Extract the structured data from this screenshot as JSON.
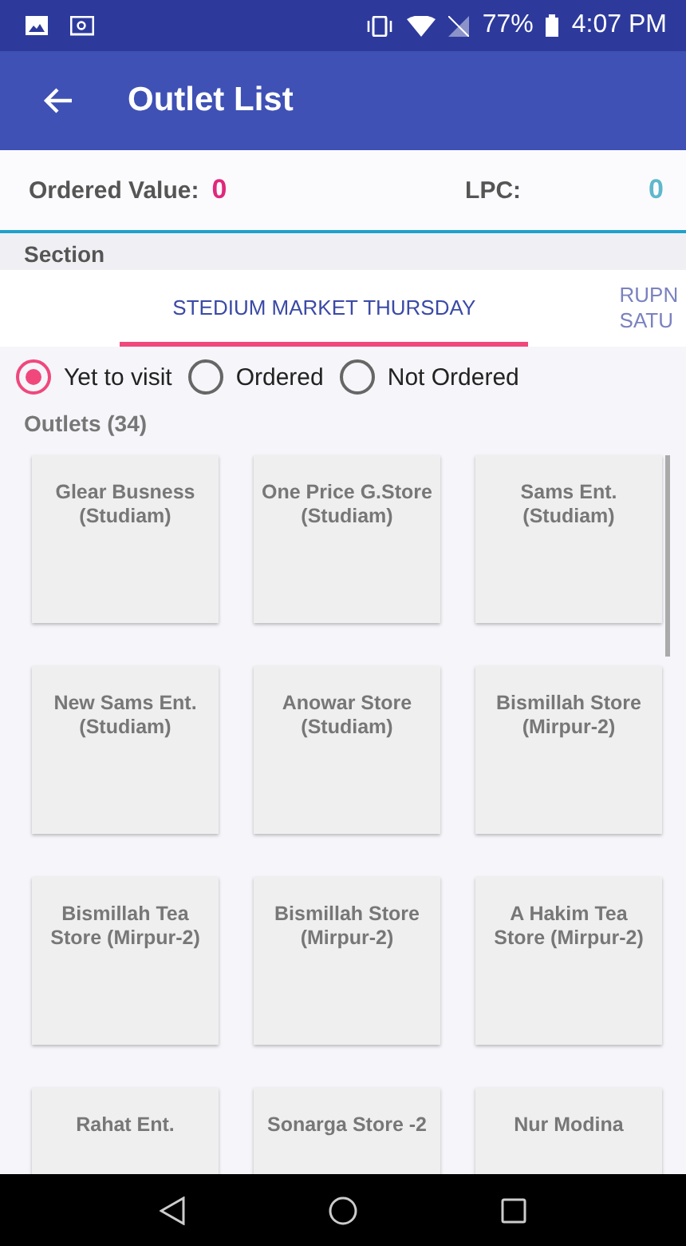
{
  "status_bar": {
    "battery": "77%",
    "time": "4:07 PM"
  },
  "app_bar": {
    "title": "Outlet List"
  },
  "summary": {
    "ordered_value_label": "Ordered Value:",
    "ordered_value": "0",
    "lpc_label": "LPC:",
    "lpc": "0"
  },
  "section_label": "Section",
  "tabs": [
    {
      "label": "STEDIUM MARKET THURSDAY",
      "selected": true
    },
    {
      "label": "RUPN SATU",
      "selected": false
    }
  ],
  "filters": [
    {
      "label": "Yet to visit",
      "selected": true
    },
    {
      "label": "Ordered",
      "selected": false
    },
    {
      "label": "Not Ordered",
      "selected": false
    }
  ],
  "outlets_label": "Outlets (34)",
  "outlets": [
    "Glear Busness (Studiam)",
    "One Price G.Store (Studiam)",
    "Sams Ent. (Studiam)",
    "New Sams Ent. (Studiam)",
    "Anowar Store (Studiam)",
    "Bismillah Store (Mirpur-2)",
    "Bismillah Tea Store (Mirpur-2)",
    "Bismillah Store (Mirpur-2)",
    "A Hakim Tea Store (Mirpur-2)",
    "Rahat Ent.",
    "Sonarga Store -2",
    "Nur Modina"
  ]
}
